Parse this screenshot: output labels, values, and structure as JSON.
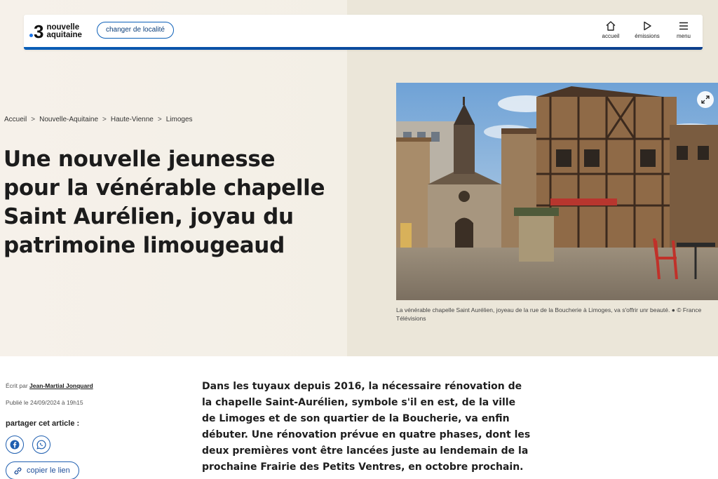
{
  "header": {
    "logo_number": "3",
    "logo_line1": "nouvelle",
    "logo_line2": "aquitaine",
    "locality_button": "changer de localité",
    "nav": {
      "home": "accueil",
      "shows": "émissions",
      "menu": "menu"
    }
  },
  "breadcrumb": [
    "Accueil",
    "Nouvelle-Aquitaine",
    "Haute-Vienne",
    "Limoges"
  ],
  "article": {
    "title": "Une nouvelle jeunesse pour la vénérable chapelle Saint Aurélien, joyau du patrimoine limougeaud",
    "caption": "La vénérable chapelle Saint Aurélien, joyeau de la rue de la Boucherie à Limoges, va s'offrir unr beauté. ● © France Télévisions",
    "written_by_label": "Écrit par",
    "author": "Jean-Martial Jonquard",
    "published": "Publié le 24/09/2024 à 19h15",
    "share_label": "partager cet article :",
    "copy_link": "copier le lien",
    "lead": "Dans les tuyaux depuis 2016, la nécessaire rénovation de la chapelle Saint-Aurélien, symbole s'il en est, de la ville de Limoges et de son quartier de la Boucherie, va enfin débuter. Une rénovation prévue en quatre phases, dont les deux premières vont être lancées juste au lendemain de la prochaine Frairie des Petits Ventres, en octobre prochain."
  },
  "icons": {
    "home": "home-icon",
    "shows": "play-icon",
    "menu": "hamburger-icon",
    "expand": "expand-icon",
    "facebook": "facebook-icon",
    "whatsapp": "whatsapp-icon",
    "link": "link-icon"
  },
  "colors": {
    "brand_blue": "#0b5fb8",
    "hero_bg": "#f4efe7",
    "text": "#1c1c1c"
  }
}
